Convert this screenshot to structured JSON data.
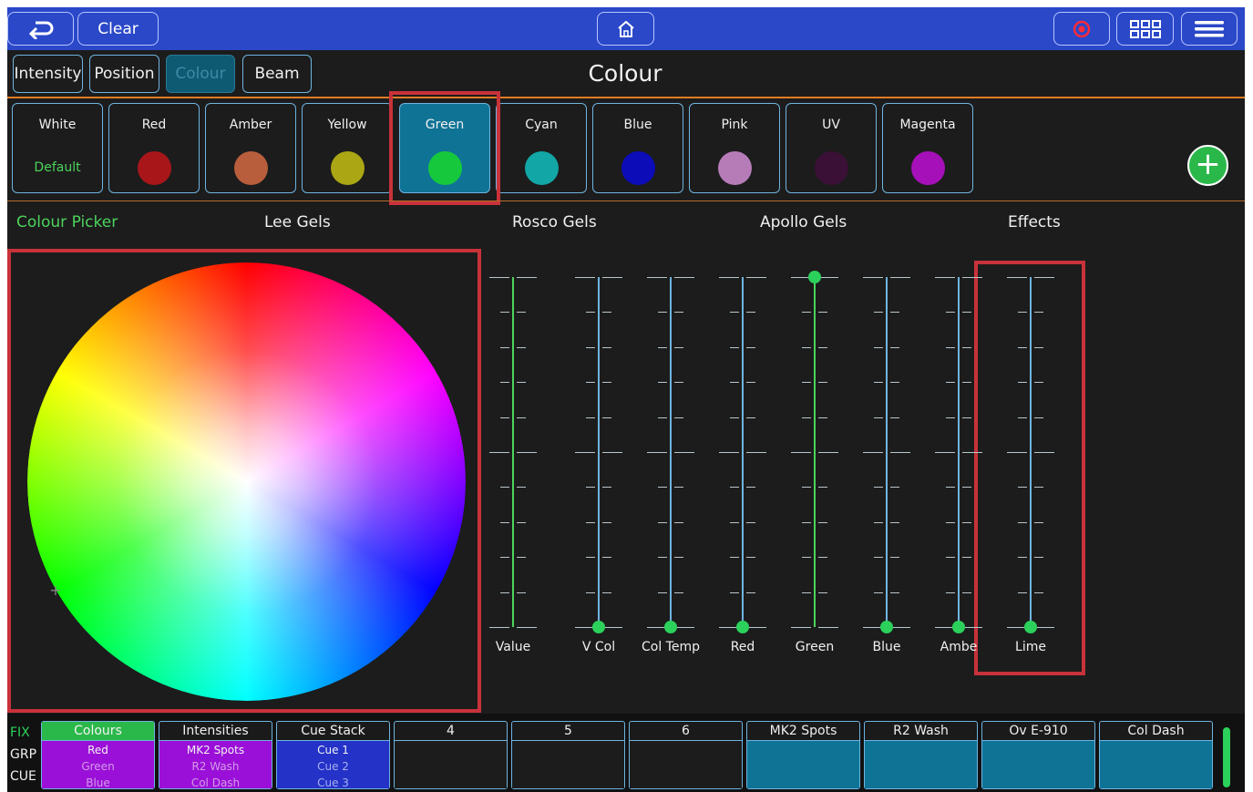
{
  "topbar": {
    "back_icon": "back-arrow-icon",
    "clear_label": "Clear",
    "home_icon": "home-icon",
    "record_icon": "record-icon",
    "grid_icon": "grid-icon",
    "menu_icon": "menu-icon"
  },
  "attribute_tabs": [
    "Intensity",
    "Position",
    "Colour",
    "Beam"
  ],
  "page_title": "Colour",
  "palettes": [
    {
      "label": "White",
      "sub": "Default",
      "color": null
    },
    {
      "label": "Red",
      "color": "#a8161a"
    },
    {
      "label": "Amber",
      "color": "#b85e3c"
    },
    {
      "label": "Yellow",
      "color": "#aaa614"
    },
    {
      "label": "Green",
      "color": "#16c83c",
      "active": true
    },
    {
      "label": "Cyan",
      "color": "#12a6a6"
    },
    {
      "label": "Blue",
      "color": "#0c0cb8"
    },
    {
      "label": "Pink",
      "color": "#b67cb8"
    },
    {
      "label": "UV",
      "color": "#3a1036"
    },
    {
      "label": "Magenta",
      "color": "#a610b8"
    }
  ],
  "sub_tabs": [
    "Colour Picker",
    "Lee Gels",
    "Rosco Gels",
    "Apollo Gels",
    "Effects"
  ],
  "faders": [
    {
      "label": "Value",
      "level": 1.0,
      "track": "green",
      "thumb": false
    },
    {
      "label": "V Col",
      "level": 0.0,
      "track": "blue",
      "thumb": true
    },
    {
      "label": "Col Temp",
      "level": 0.0,
      "track": "blue",
      "thumb": true
    },
    {
      "label": "Red",
      "level": 0.0,
      "track": "blue",
      "thumb": true
    },
    {
      "label": "Green",
      "level": 1.0,
      "track": "green",
      "thumb": true
    },
    {
      "label": "Blue",
      "level": 0.0,
      "track": "blue",
      "thumb": true
    },
    {
      "label": "Ambe",
      "level": 0.0,
      "track": "blue",
      "thumb": true
    },
    {
      "label": "Lime",
      "level": 0.0,
      "track": "blue",
      "thumb": true
    }
  ],
  "modes": [
    "FIX",
    "GRP",
    "CUE"
  ],
  "handles": [
    {
      "header": "Colours",
      "lines": [
        "Red",
        "Green",
        "Blue"
      ],
      "style": "purple",
      "active": true
    },
    {
      "header": "Intensities",
      "lines": [
        "MK2 Spots",
        "R2 Wash",
        "Col Dash"
      ],
      "style": "purple"
    },
    {
      "header": "Cue Stack",
      "lines": [
        "Cue 1",
        "Cue 2",
        "Cue 3"
      ],
      "style": "blue"
    },
    {
      "header": "4",
      "lines": [],
      "style": "dark"
    },
    {
      "header": "5",
      "lines": [],
      "style": "dark"
    },
    {
      "header": "6",
      "lines": [],
      "style": "dark"
    },
    {
      "header": "MK2 Spots",
      "lines": [],
      "style": "teal"
    },
    {
      "header": "R2 Wash",
      "lines": [],
      "style": "teal"
    },
    {
      "header": "Ov E-910",
      "lines": [],
      "style": "teal"
    },
    {
      "header": "Col Dash",
      "lines": [],
      "style": "teal"
    }
  ],
  "colors": {
    "accent_blue": "#2a48c8",
    "accent_green": "#2bd15a",
    "highlight_red": "#c8323a",
    "orange_rule": "#e07b22"
  }
}
